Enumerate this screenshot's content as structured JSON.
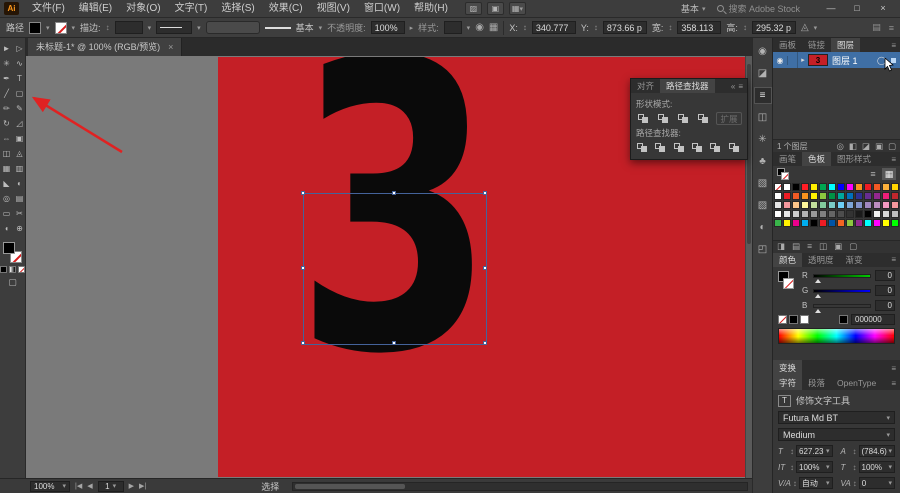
{
  "window": {
    "minimize": "—",
    "maximize": "□",
    "close": "×"
  },
  "ui_icons": {
    "stepper": "↕",
    "arrow_down": "▾",
    "menu": "≡",
    "collapse": "«",
    "eye": "◉",
    "triangle_right": "▸",
    "arrange": "▦",
    "stock": "▨",
    "bridge": "▣",
    "recolor": "◉",
    "align_cb": "▦",
    "shuffle": "◬",
    "panel_a": "▤",
    "panel_b": "≡",
    "drawmode": "▢"
  },
  "menubar": {
    "logo": "Ai",
    "items": [
      "文件(F)",
      "编辑(E)",
      "对象(O)",
      "文字(T)",
      "选择(S)",
      "效果(C)",
      "视图(V)",
      "窗口(W)",
      "帮助(H)"
    ],
    "workspace": "基本",
    "search": "搜索 Adobe Stock"
  },
  "controlbar": {
    "object_label": "路径",
    "fill_color": "#000000",
    "stroke_color": "none",
    "stroke_label": "描边:",
    "brush_name": "基本",
    "opacity_label": "不透明度:",
    "opacity_value": "100%",
    "style_label": "样式:",
    "x_label": "X:",
    "x_value": "340.777",
    "y_label": "Y:",
    "y_value": "873.66 p",
    "w_label": "宽:",
    "w_value": "358.113",
    "h_label": "高:",
    "h_value": "295.32 p"
  },
  "doc_tab": {
    "title": "未标题-1* @ 100% (RGB/预览)"
  },
  "toolbar": {
    "tools": [
      {
        "name": "selection-tool",
        "glyph": "►"
      },
      {
        "name": "direct-selection-tool",
        "glyph": "▷"
      },
      {
        "name": "magic-wand-tool",
        "glyph": "✳"
      },
      {
        "name": "lasso-tool",
        "glyph": "∿"
      },
      {
        "name": "pen-tool",
        "glyph": "✒"
      },
      {
        "name": "type-tool",
        "glyph": "T"
      },
      {
        "name": "line-segment-tool",
        "glyph": "╱"
      },
      {
        "name": "rectangle-tool",
        "glyph": "▢"
      },
      {
        "name": "paintbrush-tool",
        "glyph": "✏"
      },
      {
        "name": "pencil-tool",
        "glyph": "✎"
      },
      {
        "name": "rotate-tool",
        "glyph": "↻"
      },
      {
        "name": "scale-tool",
        "glyph": "◿"
      },
      {
        "name": "width-tool",
        "glyph": "⇔"
      },
      {
        "name": "free-transform-tool",
        "glyph": "▣"
      },
      {
        "name": "shape-builder-tool",
        "glyph": "◫"
      },
      {
        "name": "perspective-grid-tool",
        "glyph": "◬"
      },
      {
        "name": "mesh-tool",
        "glyph": "▦"
      },
      {
        "name": "gradient-tool",
        "glyph": "▥"
      },
      {
        "name": "eyedropper-tool",
        "glyph": "◣"
      },
      {
        "name": "blend-tool",
        "glyph": "◐"
      },
      {
        "name": "symbol-sprayer-tool",
        "glyph": "◎"
      },
      {
        "name": "column-graph-tool",
        "glyph": "▤"
      },
      {
        "name": "artboard-tool",
        "glyph": "▭"
      },
      {
        "name": "slice-tool",
        "glyph": "✂"
      },
      {
        "name": "hand-tool",
        "glyph": "◖"
      },
      {
        "name": "zoom-tool",
        "glyph": "⊕"
      }
    ]
  },
  "canvas": {
    "digit": "3",
    "artboard_color": "#c41f26",
    "selection_color": "#44639b"
  },
  "pathfinder_panel": {
    "tabs": [
      "对齐",
      "路径查找器"
    ],
    "active_tab": "路径查找器",
    "shape_modes_label": "形状模式:",
    "shape_modes": [
      {
        "name": "unite"
      },
      {
        "name": "minus-front"
      },
      {
        "name": "intersect"
      },
      {
        "name": "exclude"
      }
    ],
    "expand_button": "扩展",
    "pathfinders_label": "路径查找器:",
    "pathfinders": [
      {
        "name": "divide"
      },
      {
        "name": "trim"
      },
      {
        "name": "merge"
      },
      {
        "name": "crop"
      },
      {
        "name": "outline"
      },
      {
        "name": "minus-back"
      }
    ]
  },
  "dock_strip": {
    "icons": [
      {
        "name": "color-themes",
        "glyph": "◉"
      },
      {
        "name": "graphic-styles",
        "glyph": "◪"
      },
      {
        "name": "stroke-panel",
        "glyph": "≡"
      },
      {
        "name": "transform-panel",
        "glyph": "◫"
      },
      {
        "name": "symbol-sprayer-panel",
        "glyph": "✳"
      },
      {
        "name": "symbols-panel",
        "glyph": "♣"
      },
      {
        "name": "image-trace-panel",
        "glyph": "▧"
      },
      {
        "name": "pattern-panel",
        "glyph": "▨"
      },
      {
        "name": "appearance-panel",
        "glyph": "◐"
      },
      {
        "name": "export-panel",
        "glyph": "◰"
      }
    ]
  },
  "layers_panel": {
    "tabs": [
      "画板",
      "链接",
      "图层"
    ],
    "active_tab": "图层",
    "layer_name": "图层 1",
    "target_icon": "◯",
    "status": "1 个图层",
    "buttons": [
      {
        "name": "locate-object",
        "glyph": "◎"
      },
      {
        "name": "make-clip-mask",
        "glyph": "◧"
      },
      {
        "name": "new-sublayer",
        "glyph": "◪"
      },
      {
        "name": "new-layer",
        "glyph": "▣"
      },
      {
        "name": "delete-layer",
        "glyph": "▢"
      }
    ]
  },
  "swatches_panel": {
    "tabs": [
      "画笔",
      "色板",
      "图形样式"
    ],
    "active_tab": "色板",
    "view_buttons": [
      {
        "name": "list-view",
        "glyph": "≡"
      },
      {
        "name": "grid-view",
        "glyph": "▦"
      }
    ],
    "swatches": [
      "none",
      "#FFFFFF",
      "#000000",
      "#FF1D25",
      "#FFF000",
      "#00A651",
      "#00FFFF",
      "#0000FF",
      "#FF00FF",
      "#F7931E",
      "#ED1C24",
      "#F15A24",
      "#FBB03B",
      "#FFD400",
      "#FFFFFF",
      "#ED1C24",
      "#F15A24",
      "#F7931E",
      "#FFF200",
      "#8CC63F",
      "#009245",
      "#00A99D",
      "#0071BC",
      "#2E3192",
      "#662D91",
      "#93278F",
      "#ED1E79",
      "#C1272D",
      "#E6E6E6",
      "#F5989D",
      "#FDC68A",
      "#FFF79A",
      "#C4DF9B",
      "#82CA9D",
      "#7BCDC8",
      "#6ECFF6",
      "#7EA7D8",
      "#8493CA",
      "#A187BE",
      "#BC8DBF",
      "#F49AC2",
      "#F6989D",
      "#FFFFFF",
      "#E6E6E6",
      "#CCCCCC",
      "#B3B3B3",
      "#999999",
      "#808080",
      "#666666",
      "#4D4D4D",
      "#333333",
      "#1A1A1A",
      "#000000",
      "#F2F2F2",
      "#D9D9D9",
      "#BFBFBF",
      "#39B54A",
      "#FFF200",
      "#EC008C",
      "#00AEEF",
      "#000000",
      "#ED1C24",
      "#0054A6",
      "#F26522",
      "#8DC63F",
      "#92278F",
      "#00FFFF",
      "#FF00FF",
      "#FFFF00",
      "#00FF00"
    ],
    "buttons": [
      {
        "name": "swatch-libraries",
        "glyph": "◨"
      },
      {
        "name": "swatch-kinds",
        "glyph": "▤"
      },
      {
        "name": "swatch-options",
        "glyph": "≡"
      },
      {
        "name": "new-color-group",
        "glyph": "◫"
      },
      {
        "name": "new-swatch",
        "glyph": "▣"
      },
      {
        "name": "delete-swatch",
        "glyph": "▢"
      }
    ]
  },
  "color_panel": {
    "tabs": [
      "颜色",
      "透明度",
      "渐变"
    ],
    "active_tab": "颜色",
    "sliders": [
      {
        "label": "R",
        "value": "0",
        "color": "#FF0000"
      },
      {
        "label": "G",
        "value": "0",
        "color": "#00CC00"
      },
      {
        "label": "B",
        "value": "0",
        "color": "#0000FF"
      }
    ],
    "hex": "000000"
  },
  "transform_panel": {
    "title": "变换"
  },
  "character_panel": {
    "tabs": [
      "字符",
      "段落",
      "OpenType"
    ],
    "active_tab": "字符",
    "touch_tool": "修饰文字工具",
    "font_family": "Futura Md BT",
    "font_style": "Medium",
    "fields": [
      {
        "name": "font-size",
        "icon": "T",
        "value": "627.23"
      },
      {
        "name": "leading",
        "icon": "A",
        "value": "(784.6)"
      },
      {
        "name": "vertical-scale",
        "icon": "IT",
        "value": "100%"
      },
      {
        "name": "horizontal-scale",
        "icon": "T",
        "value": "100%"
      },
      {
        "name": "kerning",
        "icon": "V/A",
        "value": "自动"
      },
      {
        "name": "tracking",
        "icon": "VA",
        "value": "0"
      }
    ]
  },
  "statusbar": {
    "zoom": "100%",
    "nav_first": "|◀",
    "nav_prev": "◀",
    "artboard_number": "1",
    "nav_next": "▶",
    "nav_last": "▶|",
    "status": "选择"
  }
}
